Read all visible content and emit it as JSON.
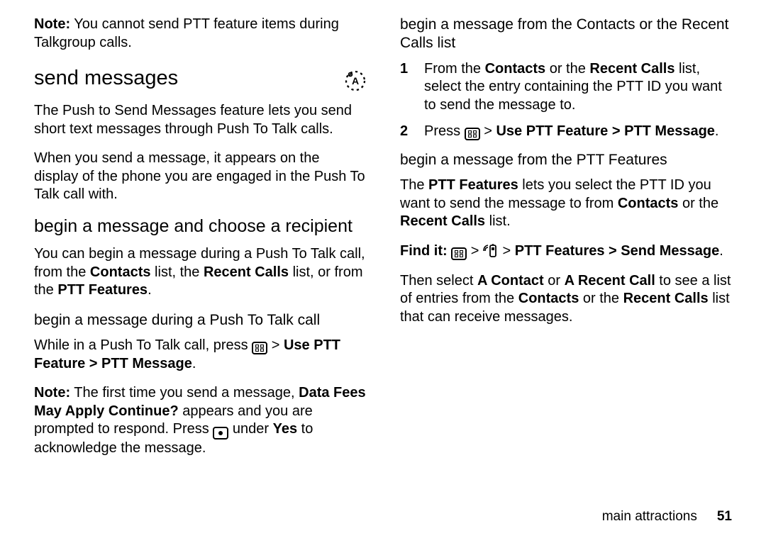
{
  "col1": {
    "note1_label": "Note:",
    "note1_text": " You cannot send PTT feature items during Talkgroup calls.",
    "h1": "send messages",
    "p1": "The Push to Send Messages feature lets you send short text messages through Push To Talk calls.",
    "p2": "When you send a message, it appears on the display of the phone you are engaged in the Push To Talk call with.",
    "h2": "begin a message and choose a recipient",
    "p3a": "You can begin a message during a Push To Talk call, from the ",
    "p3_contacts": "Contacts",
    "p3b": " list, the ",
    "p3_recent": "Recent Calls",
    "p3c": " list, or from the ",
    "p3_ptt": "PTT Features",
    "p3d": ".",
    "h3": "begin a message during a Push To Talk call",
    "p4a": "While in a Push To Talk call, press ",
    "p4b": " > ",
    "p4_cmd": "Use PTT Feature > PTT Message",
    "p4c": "."
  },
  "col2": {
    "note_label": "Note:",
    "note_a": " The first time you send a message, ",
    "note_b": "Data Fees May Apply Continue?",
    "note_c": " appears and you are prompted to respond. Press ",
    "note_d": " under ",
    "note_yes": "Yes",
    "note_e": " to acknowledge the message.",
    "h3a": "begin a message from the Contacts or the Recent Calls list",
    "s1a": "From the ",
    "s1_contacts": "Contacts",
    "s1b": " or the ",
    "s1_recent": "Recent Calls",
    "s1c": " list, select the entry containing the PTT ID you want to send the message to.",
    "s2a": "Press ",
    "s2b": " > ",
    "s2_cmd": "Use PTT Feature > PTT Message",
    "s2c": ".",
    "h3b": "begin a message from the PTT Features",
    "p5a": "The ",
    "p5_ptt": "PTT Features",
    "p5b": " lets you select the PTT ID you want to send the message to from ",
    "p5_contacts": "Contacts",
    "p5c": " or the ",
    "p5_recent": "Recent Calls",
    "p5d": " list.",
    "find_label": "Find it: ",
    "find_b": " > ",
    "find_c": " > ",
    "find_cmd": "PTT Features > Send Message",
    "find_d": ".",
    "p6a": "Then select ",
    "p6_ac": "A Contact",
    "p6b": " or ",
    "p6_ar": "A Recent Call",
    "p6c": " to see a list of entries from the ",
    "p6_contacts": "Contacts",
    "p6d": " or the ",
    "p6_recent": "Recent Calls",
    "p6e": " list that can receive messages."
  },
  "footer": {
    "label": "main attractions",
    "page": "51"
  }
}
